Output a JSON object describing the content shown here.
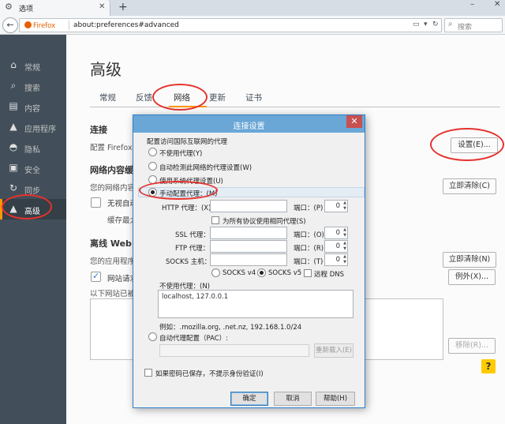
{
  "browser": {
    "tab_title": "选项",
    "url_identity": "Firefox",
    "url": "about:preferences#advanced",
    "search_placeholder": "搜索"
  },
  "sidebar": {
    "items": [
      {
        "label": "常规",
        "icon": "home-icon"
      },
      {
        "label": "搜索",
        "icon": "search-icon"
      },
      {
        "label": "内容",
        "icon": "document-icon"
      },
      {
        "label": "应用程序",
        "icon": "rocket-icon"
      },
      {
        "label": "隐私",
        "icon": "mask-icon"
      },
      {
        "label": "安全",
        "icon": "lock-icon"
      },
      {
        "label": "同步",
        "icon": "sync-icon"
      },
      {
        "label": "高级",
        "icon": "wizard-hat-icon",
        "active": true
      }
    ]
  },
  "main": {
    "heading": "高级",
    "tabs": [
      "常规",
      "反馈",
      "网络",
      "更新",
      "证书"
    ],
    "selected_tab": "网络",
    "connection": {
      "title": "连接",
      "desc": "配置 Firefox",
      "settings_button": "设置(E)..."
    },
    "cache": {
      "title": "网络内容缓存",
      "desc": "您的网络内容缓",
      "clear_button": "立即清除(C)",
      "override_label": "无视自动",
      "limit_label": "缓存最大"
    },
    "offline": {
      "title": "离线 Web 内",
      "desc": "您的应用程序",
      "clear_button": "立即清除(N)",
      "exceptions_button": "例外(X)...",
      "notify_label": "网站请求",
      "list_label": "以下网站已被",
      "remove_button": "移除(R)..."
    },
    "help_label": "?"
  },
  "dialog": {
    "title": "连接设置",
    "close": "✕",
    "group_label": "配置访问国际互联网的代理",
    "options": [
      "不使用代理(Y)",
      "自动检测此网络的代理设置(W)",
      "使用系统代理设置(U)",
      "手动配置代理：(M)",
      "自动代理配置（PAC）:"
    ],
    "selected_option": 3,
    "http_label": "HTTP 代理：(X)",
    "port_label_p": "端口：(P)",
    "same_proxy_label": "为所有协议使用相同代理(S)",
    "ssl_label": "SSL 代理：",
    "port_label_o": "端口：(O)",
    "ftp_label": "FTP 代理：",
    "port_label_r": "端口：(R)",
    "socks_label": "SOCKS 主机：",
    "port_label_t": "端口：(T)",
    "port_value": "0",
    "socks_v4": "SOCKS v4",
    "socks_v5": "SOCKS v5",
    "remote_dns": "远程 DNS",
    "no_proxy_label": "不使用代理：(N)",
    "no_proxy_value": "localhost, 127.0.0.1",
    "example": "例如：.mozilla.org, .net.nz, 192.168.1.0/24",
    "reload_button": "重新载入(E)",
    "no_auth_label": "如果密码已保存，不提示身份验证(I)",
    "ok_button": "确定",
    "cancel_button": "取消",
    "help_button": "帮助(H)"
  },
  "colors": {
    "sidebar_bg": "#424f5a",
    "accent": "#ff9500",
    "dialog_title": "#6aa6d6",
    "annotation_ring": "#e5322d",
    "close_button": "#c75050"
  }
}
